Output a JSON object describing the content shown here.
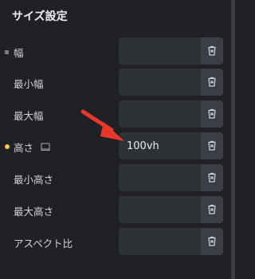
{
  "panel": {
    "title": "サイズ設定"
  },
  "rows": [
    {
      "label": "幅",
      "value": "",
      "marker": "square",
      "responsive_icon": false
    },
    {
      "label": "最小幅",
      "value": "",
      "marker": "",
      "responsive_icon": false
    },
    {
      "label": "最大幅",
      "value": "",
      "marker": "",
      "responsive_icon": false
    },
    {
      "label": "高さ",
      "value": "100vh",
      "marker": "yellow-dot",
      "responsive_icon": true
    },
    {
      "label": "最小高さ",
      "value": "",
      "marker": "",
      "responsive_icon": false
    },
    {
      "label": "最大高さ",
      "value": "",
      "marker": "",
      "responsive_icon": false
    },
    {
      "label": "アスペクト比",
      "value": "",
      "marker": "",
      "responsive_icon": false
    }
  ],
  "colors": {
    "background": "#1f2125",
    "field": "#2e3136",
    "field_button": "#3b3e44",
    "arrow": "#e8382b",
    "active_marker": "#f2c94c"
  },
  "icons": {
    "field_button": "unit-clear-icon",
    "responsive": "desktop-icon",
    "annotation": "red-arrow-icon"
  }
}
